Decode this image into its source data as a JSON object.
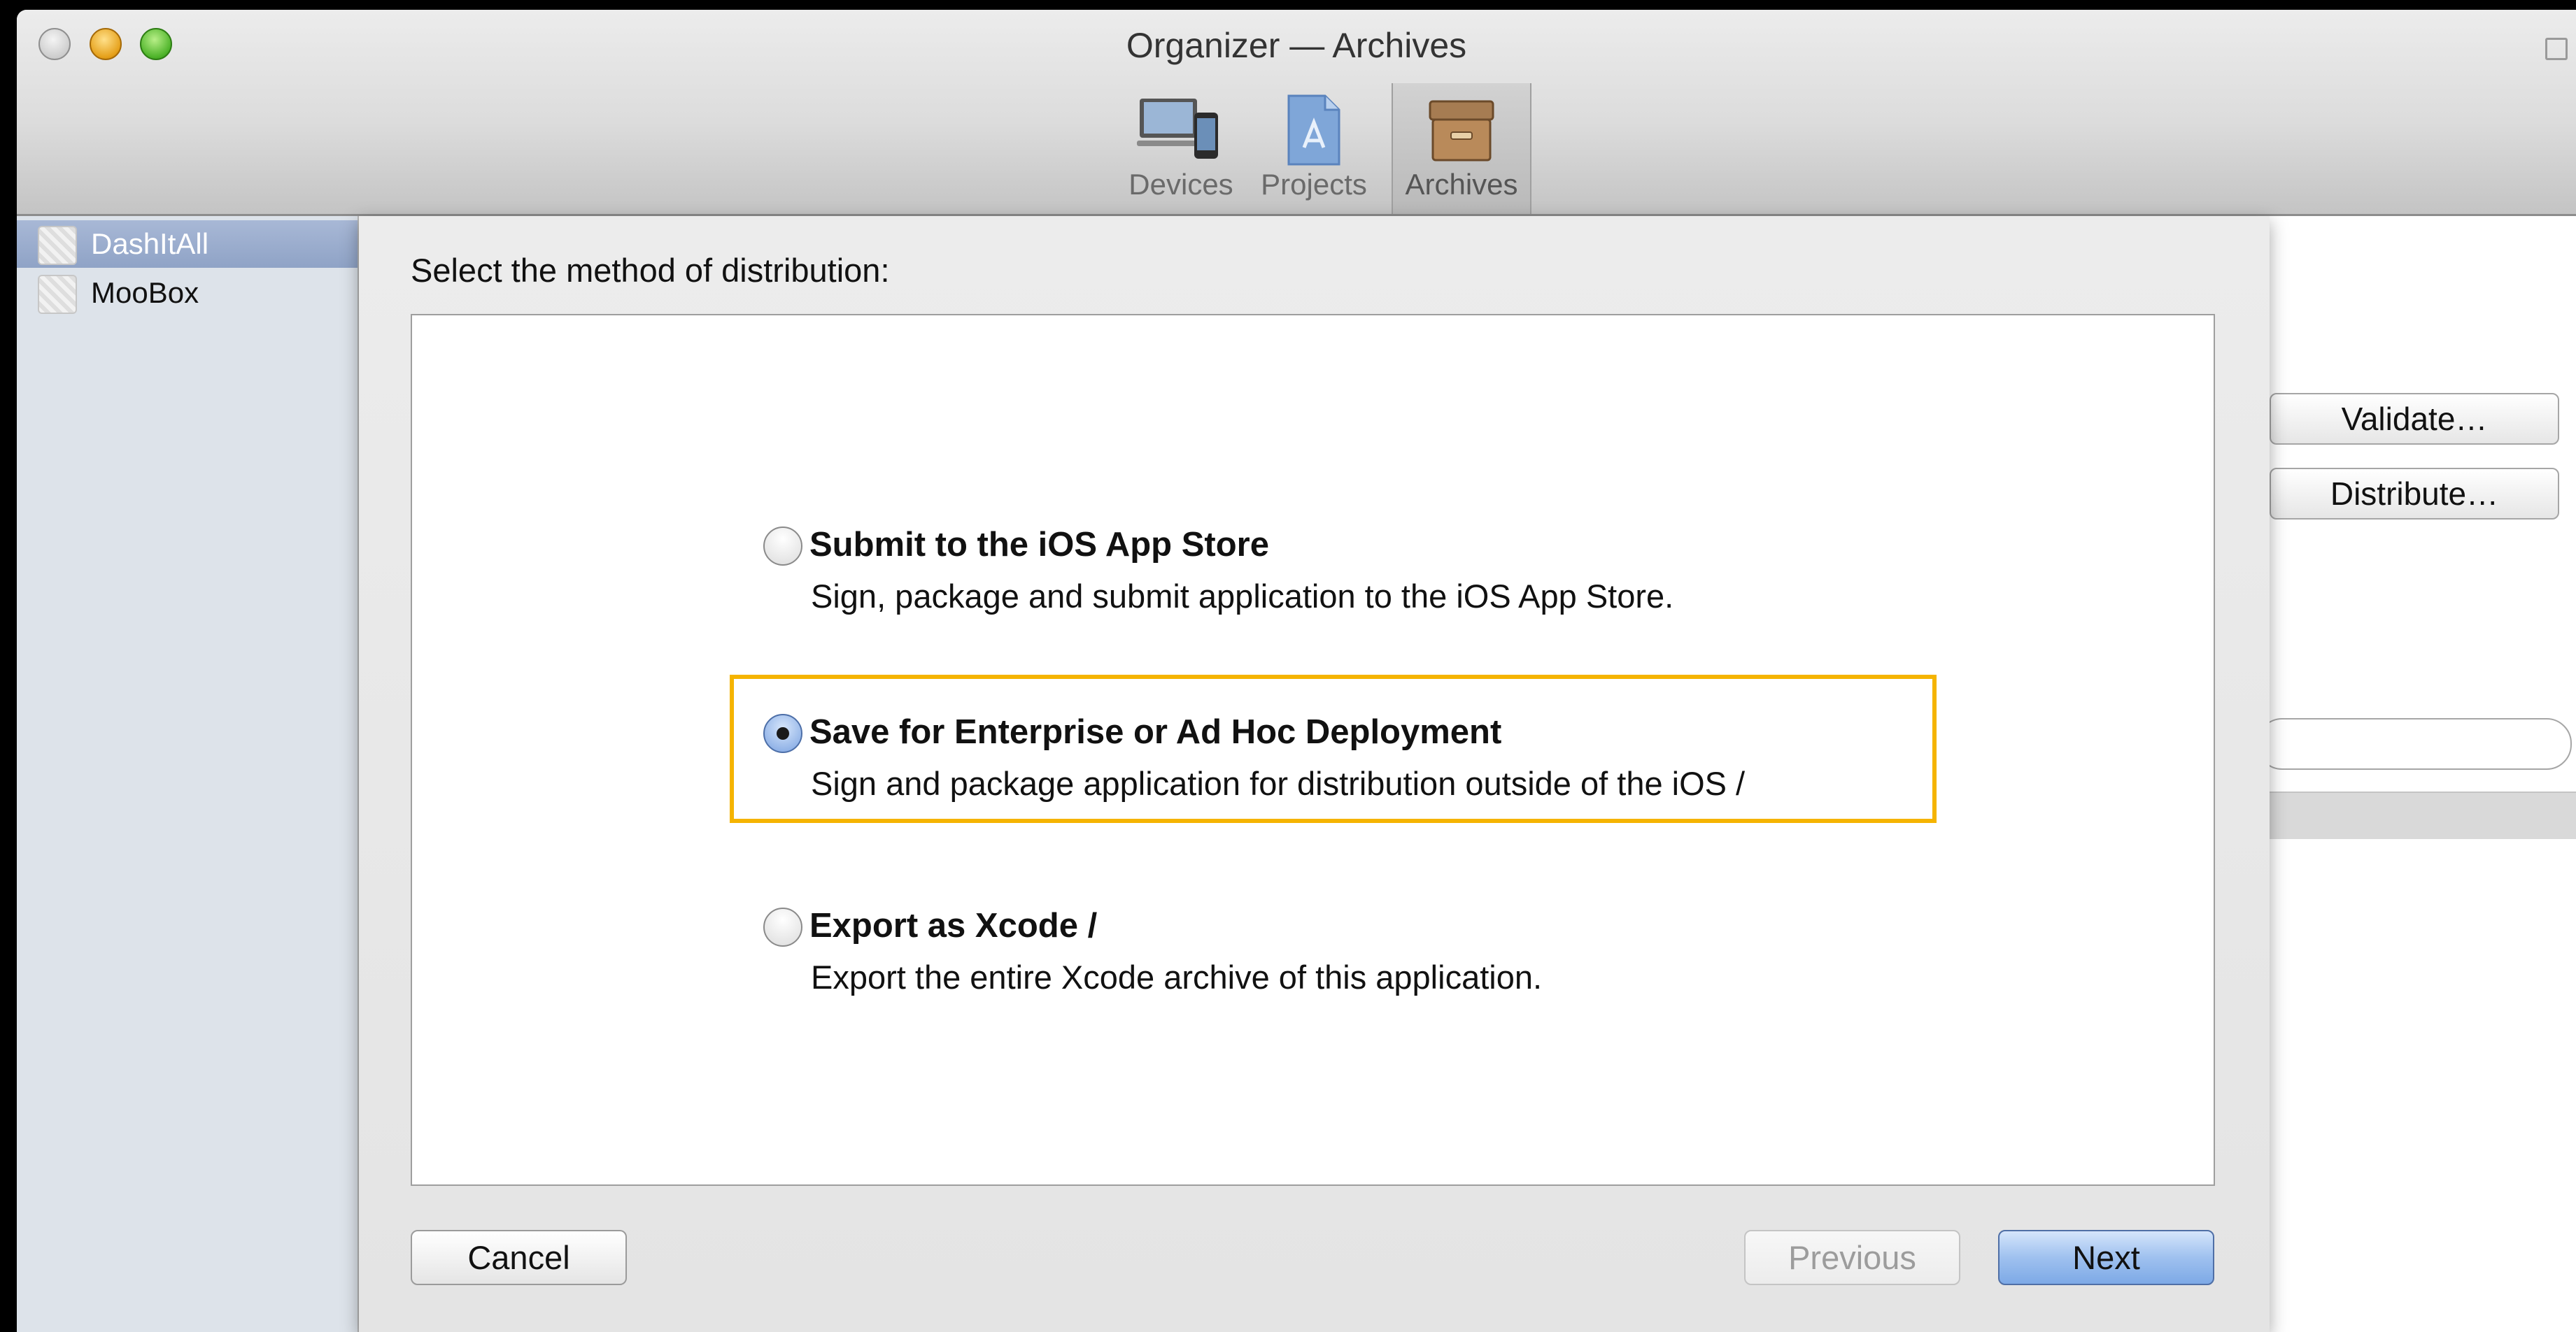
{
  "window": {
    "title": "Organizer — Archives"
  },
  "toolbar": {
    "items": [
      {
        "label": "Devices",
        "icon": "devices-icon"
      },
      {
        "label": "Projects",
        "icon": "projects-icon"
      },
      {
        "label": "Archives",
        "icon": "archives-icon",
        "selected": true
      }
    ]
  },
  "sidebar": {
    "items": [
      {
        "label": "DashItAll",
        "selected": true
      },
      {
        "label": "MooBox"
      }
    ]
  },
  "right_pane": {
    "validate_label": "Validate…",
    "distribute_label": "Distribute…"
  },
  "sheet": {
    "title": "Select the method of distribution:",
    "options": [
      {
        "title": "Submit to the iOS App Store",
        "description": "Sign, package and submit application to the iOS App Store.",
        "selected": false
      },
      {
        "title": "Save for Enterprise or Ad Hoc Deployment",
        "description": "Sign and package application for distribution outside of the iOS /",
        "selected": true
      },
      {
        "title": "Export as Xcode /",
        "description": "Export the entire Xcode archive of this application.",
        "selected": false
      }
    ],
    "cancel_label": "Cancel",
    "previous_label": "Previous",
    "next_label": "Next"
  },
  "colors": {
    "highlight": "#f5b400",
    "selection": "#8fa3c6",
    "primary_button": "#9fc1ef"
  }
}
